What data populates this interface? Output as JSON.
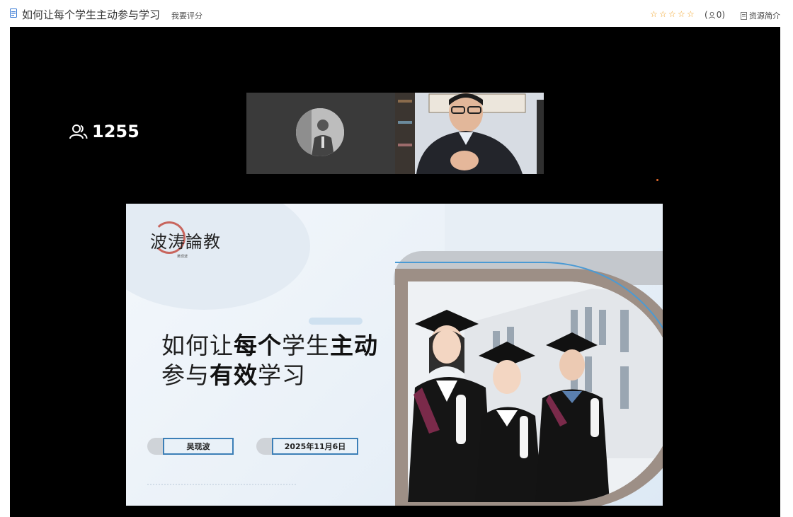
{
  "header": {
    "doc_icon": "document-icon",
    "title": "如何让每个学生主动参与学习",
    "rate_link": "我要评分",
    "stars": [
      "☆",
      "☆",
      "☆",
      "☆",
      "☆"
    ],
    "rating_count": "0",
    "rating_open": "(",
    "rating_close": ")",
    "intro_link": "资源简介"
  },
  "video": {
    "viewer_icon": "users-icon",
    "viewer_count": "1255"
  },
  "slide": {
    "logo_text": "波涛論教",
    "logo_subtitle": "吴现波",
    "title_line1_pre": "如何让",
    "title_line1_b1": "每个",
    "title_line1_mid": "学生",
    "title_line1_b2": "主动",
    "title_line2_pre": "参与",
    "title_line2_b": "有效",
    "title_line2_post": "学习",
    "author": "吴现波",
    "date": "2025年11月6日"
  },
  "colors": {
    "star": "#f0a020",
    "frame": "#9d8f86",
    "accent_blue": "#3c7fb7",
    "video_bg": "#000000"
  }
}
